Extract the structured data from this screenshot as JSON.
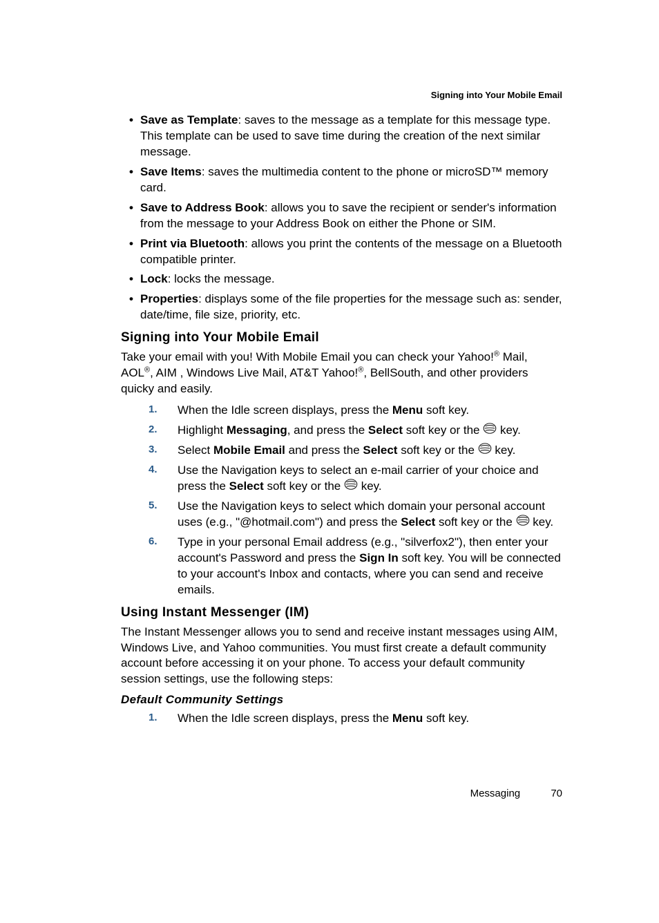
{
  "runningHeader": "Signing into Your Mobile Email",
  "bullets": [
    {
      "title": "Save as Template",
      "text": ": saves to the message as a template for this message type. This template can be used to save time during the creation of the next similar message."
    },
    {
      "title": "Save Items",
      "text": ": saves the multimedia content to the phone or microSD™ memory card."
    },
    {
      "title": "Save to Address Book",
      "text": ": allows you to save the recipient or sender's information from the message to your Address Book on either the Phone or SIM."
    },
    {
      "title": "Print via Bluetooth",
      "text": ": allows you print the contents of the message on a Bluetooth compatible printer."
    },
    {
      "title": "Lock",
      "text": ": locks the message."
    },
    {
      "title": "Properties",
      "text": ": displays some of the file properties for the message such as: sender, date/time, file size, priority, etc."
    }
  ],
  "section1": {
    "heading": "Signing into Your Mobile Email",
    "intro_pre": "Take your email with you! With Mobile Email you can check your Yahoo!",
    "intro_mid1": " Mail, AOL",
    "intro_mid2": ", AIM , Windows Live Mail, AT&T Yahoo!",
    "intro_post": ", BellSouth, and other providers quicky and easily.",
    "steps": [
      {
        "n": "1.",
        "pre": "When the Idle screen displays, press the ",
        "b1": "Menu",
        "post1": " soft key."
      },
      {
        "n": "2.",
        "pre": "Highlight ",
        "b1": "Messaging",
        "mid1": ", and press the ",
        "b2": "Select",
        "mid2": " soft key or the ",
        "icon": true,
        "post": " key."
      },
      {
        "n": "3.",
        "pre": "Select ",
        "b1": "Mobile Email",
        "mid1": " and press the ",
        "b2": "Select",
        "mid2": " soft key or the ",
        "icon": true,
        "post": " key."
      },
      {
        "n": "4.",
        "pre": "Use the Navigation keys to select an e-mail carrier of your choice and press the ",
        "b1": "Select",
        "mid1": " soft key or the ",
        "icon": true,
        "post": " key."
      },
      {
        "n": "5.",
        "pre": "Use the Navigation keys to select which domain your personal account uses (e.g., \"@hotmail.com\") and press the ",
        "b1": "Select",
        "mid1": " soft key or the ",
        "icon": true,
        "post": " key."
      },
      {
        "n": "6.",
        "pre": "Type in your personal Email address (e.g., \"silverfox2\"), then enter your account's Password and press the ",
        "b1": "Sign In",
        "mid1": " soft key. You will be connected to your account's Inbox and contacts, where you can send and receive emails."
      }
    ]
  },
  "section2": {
    "heading": "Using Instant Messenger (IM)",
    "intro": "The Instant Messenger allows you to send and receive instant messages using AIM, Windows Live, and Yahoo communities. You must first create a default community account before accessing it on your phone. To access your default community session settings, use the following steps:"
  },
  "subSection": {
    "heading": "Default Community Settings",
    "steps": [
      {
        "n": "1.",
        "pre": "When the Idle screen displays, press the ",
        "b1": "Menu",
        "post1": " soft key."
      }
    ]
  },
  "footer": {
    "chapter": "Messaging",
    "page": "70"
  }
}
